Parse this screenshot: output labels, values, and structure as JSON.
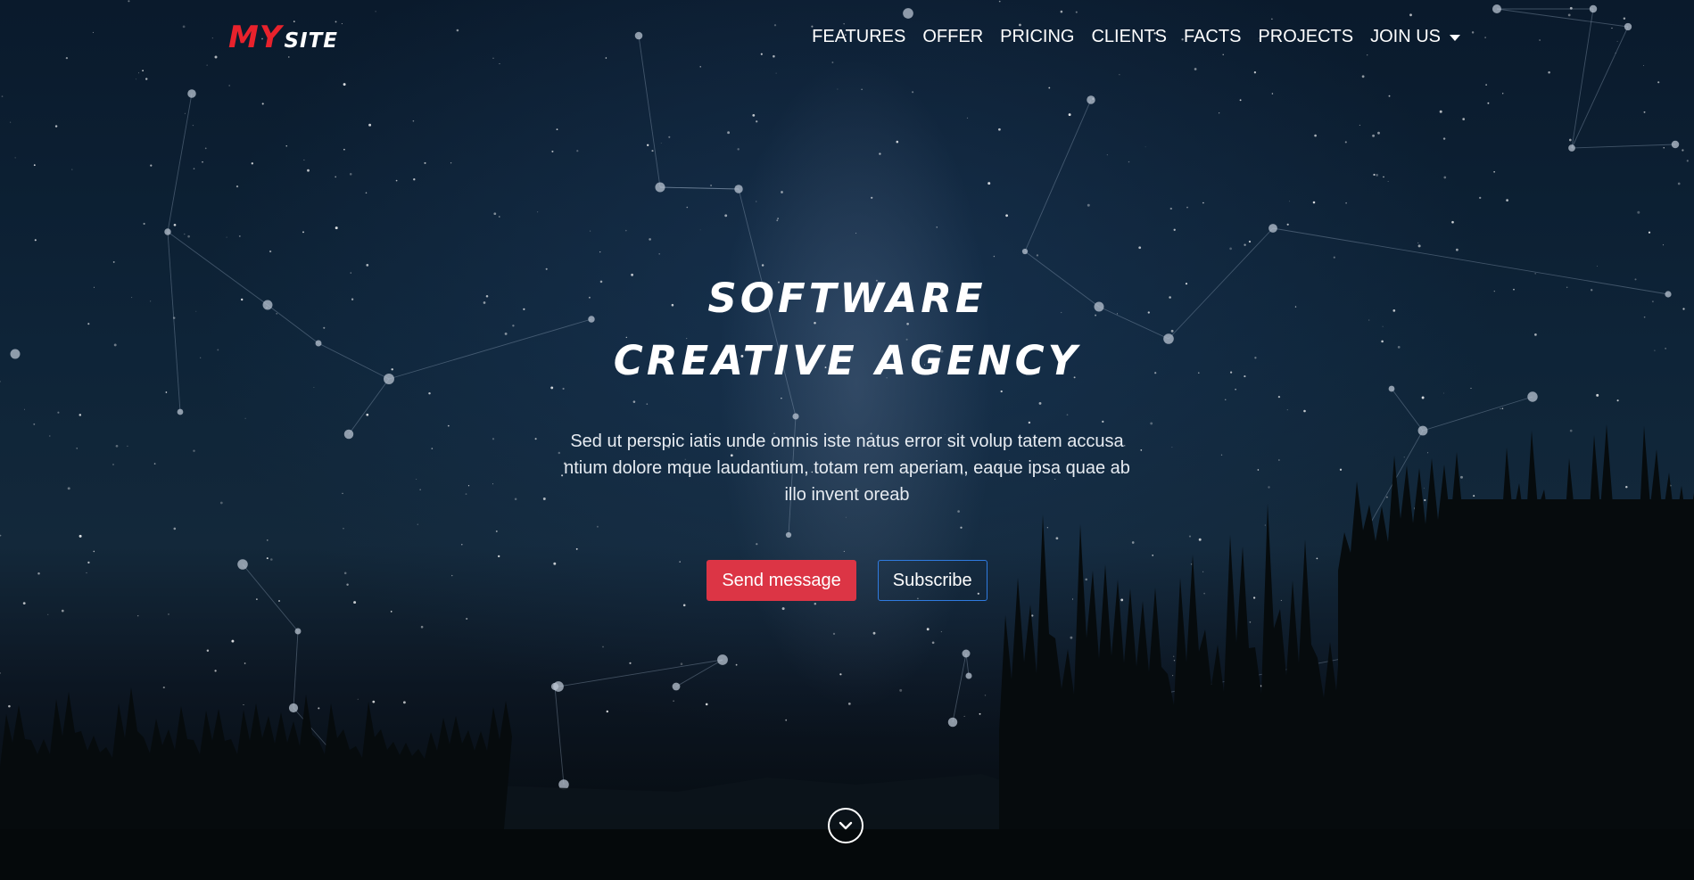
{
  "brand": {
    "part1": "MY",
    "part2": "SITE",
    "accent": "#e8222c"
  },
  "nav": {
    "items": [
      "FEATURES",
      "OFFER",
      "PRICING",
      "CLIENTS",
      "FACTS",
      "PROJECTS"
    ],
    "dropdown_label": "JOIN US"
  },
  "hero": {
    "title_line1": "SOFTWARE",
    "title_line2": "CREATIVE AGENCY",
    "text": "Sed ut perspic iatis unde omnis iste natus error sit volup tatem accusa ntium dolore mque laudantium, totam rem aperiam, eaque ipsa quae ab illo invent oreab",
    "primary_button": "Send message",
    "secondary_button": "Subscribe"
  },
  "scroll_icon": "chevron-down-icon",
  "colors": {
    "primary_button": "#dc3545",
    "outline_button_border": "#2f7be0"
  }
}
